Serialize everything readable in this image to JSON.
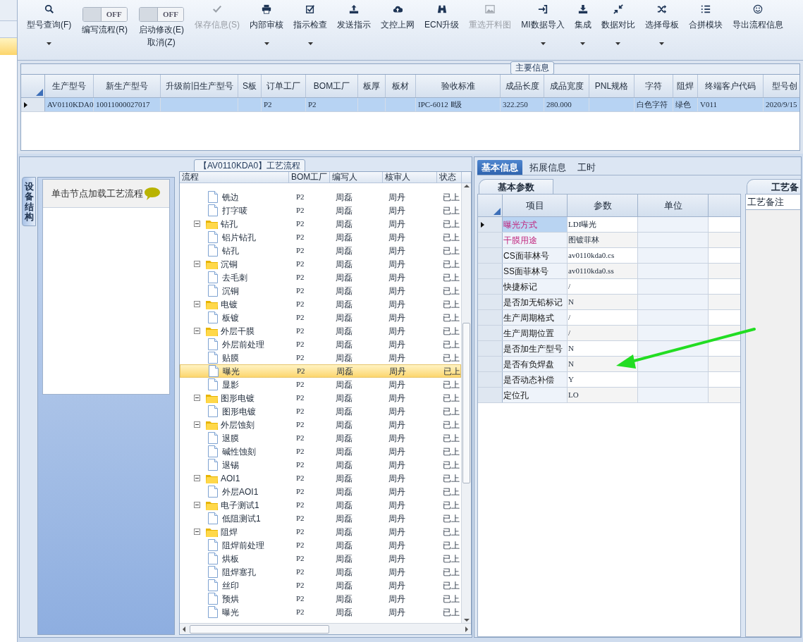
{
  "toolbar": [
    {
      "kind": "button",
      "label": "型号查询(F)",
      "dropdown": true,
      "disabled": false
    },
    {
      "kind": "toggle",
      "label": "编写流程(R)",
      "switch_text": "OFF",
      "on": false
    },
    {
      "kind": "toggle",
      "label": "启动修改(E)",
      "sub_label": "取消(Z)",
      "switch_text": "OFF",
      "on": false
    },
    {
      "kind": "button",
      "label": "保存信息(S)",
      "dropdown": false,
      "disabled": true
    },
    {
      "kind": "button",
      "label": "内部审核",
      "dropdown": true,
      "disabled": false
    },
    {
      "kind": "button",
      "label": "指示检查",
      "dropdown": true,
      "disabled": false
    },
    {
      "kind": "button",
      "label": "发送指示",
      "dropdown": false,
      "disabled": false
    },
    {
      "kind": "button",
      "label": "文控上网",
      "dropdown": false,
      "disabled": false
    },
    {
      "kind": "button",
      "label": "ECN升级",
      "dropdown": false,
      "disabled": false
    },
    {
      "kind": "button",
      "label": "重选开料图",
      "dropdown": false,
      "disabled": true
    },
    {
      "kind": "button",
      "label": "MI数据导入",
      "dropdown": true,
      "disabled": false
    },
    {
      "kind": "button",
      "label": "集成",
      "dropdown": true,
      "disabled": false
    },
    {
      "kind": "button",
      "label": "数据对比",
      "dropdown": true,
      "disabled": false
    },
    {
      "kind": "button",
      "label": "选择母板",
      "dropdown": true,
      "disabled": false
    },
    {
      "kind": "button",
      "label": "合拼模块",
      "dropdown": false,
      "disabled": false
    },
    {
      "kind": "button",
      "label": "导出流程信息",
      "dropdown": false,
      "disabled": false
    }
  ],
  "main_info": {
    "title": "主要信息",
    "columns": [
      "生产型号",
      "新生产型号",
      "升级前旧生产型号",
      "S板",
      "订单工厂",
      "BOM工厂",
      "板厚",
      "板材",
      "验收标准",
      "成品长度",
      "成品宽度",
      "PNL规格",
      "字符",
      "阻焊",
      "终端客户代码",
      "型号创"
    ],
    "rows": [
      {
        "selected": true,
        "cells": [
          "AV0110KDA0",
          "10011000027017",
          "",
          "",
          "P2",
          "P2",
          "",
          "",
          "IPC-6012 Ⅱ级",
          "322.250",
          "280.000",
          "",
          "白色字符",
          "绿色",
          "V011",
          "2020/9/15"
        ]
      }
    ]
  },
  "left_tab": "设备结构",
  "hint": "单击节点加载工艺流程",
  "flow": {
    "title": "【AV0110KDA0】工艺流程",
    "columns": [
      "流程",
      "BOM工厂",
      "编写人",
      "核审人",
      "状态"
    ],
    "tree": [
      {
        "children": [
          {
            "label": "铣边",
            "bom": "P2",
            "writer": "周磊",
            "reviewer": "周丹",
            "status": "已上",
            "selected": false
          },
          {
            "label": "打字唛",
            "bom": "P2",
            "writer": "周磊",
            "reviewer": "周丹",
            "status": "已上",
            "selected": false
          }
        ]
      },
      {
        "label": "钻孔",
        "bom": "P2",
        "writer": "周磊",
        "reviewer": "周丹",
        "status": "已上",
        "selected": false,
        "expanded": true,
        "children": [
          {
            "label": "铝片钻孔",
            "bom": "P2",
            "writer": "周磊",
            "reviewer": "周丹",
            "status": "已上",
            "selected": false
          },
          {
            "label": "钻孔",
            "bom": "P2",
            "writer": "周磊",
            "reviewer": "周丹",
            "status": "已上",
            "selected": false
          }
        ]
      },
      {
        "label": "沉铜",
        "bom": "P2",
        "writer": "周磊",
        "reviewer": "周丹",
        "status": "已上",
        "selected": false,
        "expanded": true,
        "children": [
          {
            "label": "去毛刺",
            "bom": "P2",
            "writer": "周磊",
            "reviewer": "周丹",
            "status": "已上",
            "selected": false
          },
          {
            "label": "沉铜",
            "bom": "P2",
            "writer": "周磊",
            "reviewer": "周丹",
            "status": "已上",
            "selected": false
          }
        ]
      },
      {
        "label": "电镀",
        "bom": "P2",
        "writer": "周磊",
        "reviewer": "周丹",
        "status": "已上",
        "selected": false,
        "expanded": true,
        "children": [
          {
            "label": "板镀",
            "bom": "P2",
            "writer": "周磊",
            "reviewer": "周丹",
            "status": "已上",
            "selected": false
          }
        ]
      },
      {
        "label": "外层干膜",
        "bom": "P2",
        "writer": "周磊",
        "reviewer": "周丹",
        "status": "已上",
        "selected": false,
        "expanded": true,
        "children": [
          {
            "label": "外层前处理",
            "bom": "P2",
            "writer": "周磊",
            "reviewer": "周丹",
            "status": "已上",
            "selected": false
          },
          {
            "label": "贴膜",
            "bom": "P2",
            "writer": "周磊",
            "reviewer": "周丹",
            "status": "已上",
            "selected": false
          },
          {
            "label": "曝光",
            "bom": "P2",
            "writer": "周磊",
            "reviewer": "周丹",
            "status": "已上",
            "selected": true
          },
          {
            "label": "显影",
            "bom": "P2",
            "writer": "周磊",
            "reviewer": "周丹",
            "status": "已上",
            "selected": false
          }
        ]
      },
      {
        "label": "图形电镀",
        "bom": "P2",
        "writer": "周磊",
        "reviewer": "周丹",
        "status": "已上",
        "selected": false,
        "expanded": true,
        "children": [
          {
            "label": "图形电镀",
            "bom": "P2",
            "writer": "周磊",
            "reviewer": "周丹",
            "status": "已上",
            "selected": false
          }
        ]
      },
      {
        "label": "外层蚀刻",
        "bom": "P2",
        "writer": "周磊",
        "reviewer": "周丹",
        "status": "已上",
        "selected": false,
        "expanded": true,
        "children": [
          {
            "label": "退膜",
            "bom": "P2",
            "writer": "周磊",
            "reviewer": "周丹",
            "status": "已上",
            "selected": false
          },
          {
            "label": "碱性蚀刻",
            "bom": "P2",
            "writer": "周磊",
            "reviewer": "周丹",
            "status": "已上",
            "selected": false
          },
          {
            "label": "退锡",
            "bom": "P2",
            "writer": "周磊",
            "reviewer": "周丹",
            "status": "已上",
            "selected": false
          }
        ]
      },
      {
        "label": "AOI1",
        "bom": "P2",
        "writer": "周磊",
        "reviewer": "周丹",
        "status": "已上",
        "selected": false,
        "expanded": true,
        "children": [
          {
            "label": "外层AOI1",
            "bom": "P2",
            "writer": "周磊",
            "reviewer": "周丹",
            "status": "已上",
            "selected": false
          }
        ]
      },
      {
        "label": "电子测试1",
        "bom": "P2",
        "writer": "周磊",
        "reviewer": "周丹",
        "status": "已上",
        "selected": false,
        "expanded": true,
        "children": [
          {
            "label": "低阻测试1",
            "bom": "P2",
            "writer": "周磊",
            "reviewer": "周丹",
            "status": "已上",
            "selected": false
          }
        ]
      },
      {
        "label": "阻焊",
        "bom": "P2",
        "writer": "周磊",
        "reviewer": "周丹",
        "status": "已上",
        "selected": false,
        "expanded": true,
        "children": [
          {
            "label": "阻焊前处理",
            "bom": "P2",
            "writer": "周磊",
            "reviewer": "周丹",
            "status": "已上",
            "selected": false
          },
          {
            "label": "烘板",
            "bom": "P2",
            "writer": "周磊",
            "reviewer": "周丹",
            "status": "已上",
            "selected": false
          },
          {
            "label": "阻焊塞孔",
            "bom": "P2",
            "writer": "周磊",
            "reviewer": "周丹",
            "status": "已上",
            "selected": false
          },
          {
            "label": "丝印",
            "bom": "P2",
            "writer": "周磊",
            "reviewer": "周丹",
            "status": "已上",
            "selected": false
          },
          {
            "label": "预烘",
            "bom": "P2",
            "writer": "周磊",
            "reviewer": "周丹",
            "status": "已上",
            "selected": false
          },
          {
            "label": "曝光",
            "bom": "P2",
            "writer": "周磊",
            "reviewer": "周丹",
            "status": "已上",
            "selected": false
          }
        ]
      }
    ]
  },
  "info_tabs": [
    {
      "label": "基本信息",
      "selected": true
    },
    {
      "label": "拓展信息",
      "selected": false
    },
    {
      "label": "工时",
      "selected": false
    }
  ],
  "params": {
    "tab": "基本参数",
    "columns": [
      "项目",
      "参数",
      "单位"
    ],
    "rows": [
      {
        "name": "曝光方式",
        "value": "LDI曝光",
        "required": true,
        "current": true
      },
      {
        "name": "干膜用途",
        "value": "图镀菲林",
        "required": true,
        "current": false
      },
      {
        "name": "CS面菲林号",
        "value": "av0110kda0.cs",
        "required": false,
        "current": false
      },
      {
        "name": "SS面菲林号",
        "value": "av0110kda0.ss",
        "required": false,
        "current": false
      },
      {
        "name": "快捷标记",
        "value": "/",
        "required": false,
        "current": false
      },
      {
        "name": "是否加无铅标记",
        "value": "N",
        "required": false,
        "current": false
      },
      {
        "name": "生产周期格式",
        "value": "/",
        "required": false,
        "current": false
      },
      {
        "name": "生产周期位置",
        "value": "/",
        "required": false,
        "current": false
      },
      {
        "name": "是否加生产型号",
        "value": "N",
        "required": false,
        "current": false
      },
      {
        "name": "是否有负焊盘",
        "value": "N",
        "required": false,
        "current": false
      },
      {
        "name": "是否动态补偿",
        "value": "Y",
        "required": false,
        "current": false
      },
      {
        "name": "定位孔",
        "value": "LO",
        "required": false,
        "current": false
      }
    ]
  },
  "remarks": {
    "tab": "工艺备",
    "header": "工艺备注"
  }
}
